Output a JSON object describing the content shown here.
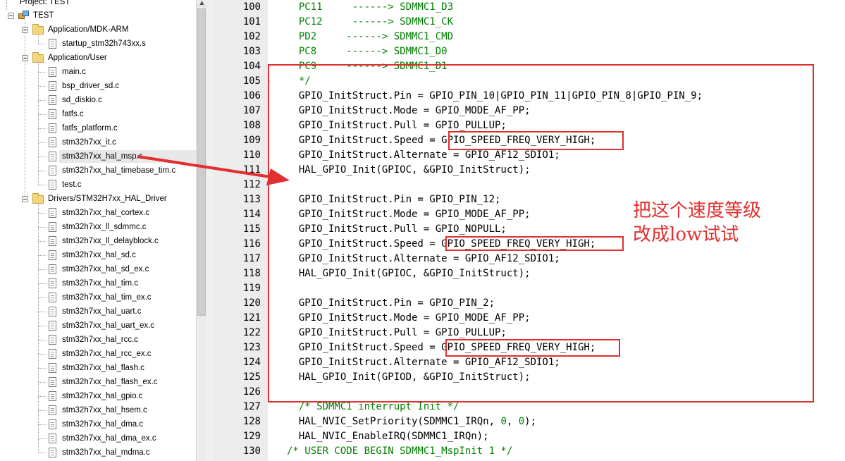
{
  "project_tree": {
    "header_label": "Project: TEST",
    "root_label": "TEST",
    "groups": [
      {
        "label": "Application/MDK-ARM",
        "files": [
          "startup_stm32h743xx.s"
        ]
      },
      {
        "label": "Application/User",
        "files": [
          "main.c",
          "bsp_driver_sd.c",
          "sd_diskio.c",
          "fatfs.c",
          "fatfs_platform.c",
          "stm32h7xx_it.c",
          "stm32h7xx_hal_msp.c",
          "stm32h7xx_hal_timebase_tim.c",
          "test.c"
        ]
      },
      {
        "label": "Drivers/STM32H7xx_HAL_Driver",
        "files": [
          "stm32h7xx_hal_cortex.c",
          "stm32h7xx_ll_sdmmc.c",
          "stm32h7xx_ll_delayblock.c",
          "stm32h7xx_hal_sd.c",
          "stm32h7xx_hal_sd_ex.c",
          "stm32h7xx_hal_tim.c",
          "stm32h7xx_hal_tim_ex.c",
          "stm32h7xx_hal_uart.c",
          "stm32h7xx_hal_uart_ex.c",
          "stm32h7xx_hal_rcc.c",
          "stm32h7xx_hal_rcc_ex.c",
          "stm32h7xx_hal_flash.c",
          "stm32h7xx_hal_flash_ex.c",
          "stm32h7xx_hal_gpio.c",
          "stm32h7xx_hal_hsem.c",
          "stm32h7xx_hal_dma.c",
          "stm32h7xx_hal_dma_ex.c",
          "stm32h7xx_hal_mdma.c"
        ]
      }
    ],
    "selected_file": "stm32h7xx_hal_msp.c"
  },
  "editor": {
    "lines": [
      {
        "no": "100",
        "text": "  PC11     ------> SDMMC1_D3",
        "kind": "comment"
      },
      {
        "no": "101",
        "text": "  PC12     ------> SDMMC1_CK",
        "kind": "comment"
      },
      {
        "no": "102",
        "text": "  PD2     ------> SDMMC1_CMD",
        "kind": "comment"
      },
      {
        "no": "103",
        "text": "  PC8     ------> SDMMC1_D0",
        "kind": "comment"
      },
      {
        "no": "104",
        "text": "  PC9     ------> SDMMC1_D1",
        "kind": "comment"
      },
      {
        "no": "105",
        "text": "  */",
        "kind": "comment"
      },
      {
        "no": "106",
        "text": "  GPIO_InitStruct.Pin = GPIO_PIN_10|GPIO_PIN_11|GPIO_PIN_8|GPIO_PIN_9;",
        "kind": "code"
      },
      {
        "no": "107",
        "text": "  GPIO_InitStruct.Mode = GPIO_MODE_AF_PP;",
        "kind": "code"
      },
      {
        "no": "108",
        "text": "  GPIO_InitStruct.Pull = GPIO_PULLUP;",
        "kind": "code"
      },
      {
        "no": "109",
        "text": "  GPIO_InitStruct.Speed = GPIO_SPEED_FREQ_VERY_HIGH;",
        "kind": "code"
      },
      {
        "no": "110",
        "text": "  GPIO_InitStruct.Alternate = GPIO_AF12_SDIO1;",
        "kind": "code"
      },
      {
        "no": "111",
        "text": "  HAL_GPIO_Init(GPIOC, &GPIO_InitStruct);",
        "kind": "code"
      },
      {
        "no": "112",
        "text": "",
        "kind": "code"
      },
      {
        "no": "113",
        "text": "  GPIO_InitStruct.Pin = GPIO_PIN_12;",
        "kind": "code"
      },
      {
        "no": "114",
        "text": "  GPIO_InitStruct.Mode = GPIO_MODE_AF_PP;",
        "kind": "code"
      },
      {
        "no": "115",
        "text": "  GPIO_InitStruct.Pull = GPIO_NOPULL;",
        "kind": "code"
      },
      {
        "no": "116",
        "text": "  GPIO_InitStruct.Speed = GPIO_SPEED_FREQ_VERY_HIGH;",
        "kind": "code"
      },
      {
        "no": "117",
        "text": "  GPIO_InitStruct.Alternate = GPIO_AF12_SDIO1;",
        "kind": "code"
      },
      {
        "no": "118",
        "text": "  HAL_GPIO_Init(GPIOC, &GPIO_InitStruct);",
        "kind": "code"
      },
      {
        "no": "119",
        "text": "",
        "kind": "code"
      },
      {
        "no": "120",
        "text": "  GPIO_InitStruct.Pin = GPIO_PIN_2;",
        "kind": "code"
      },
      {
        "no": "121",
        "text": "  GPIO_InitStruct.Mode = GPIO_MODE_AF_PP;",
        "kind": "code"
      },
      {
        "no": "122",
        "text": "  GPIO_InitStruct.Pull = GPIO_PULLUP;",
        "kind": "code"
      },
      {
        "no": "123",
        "text": "  GPIO_InitStruct.Speed = GPIO_SPEED_FREQ_VERY_HIGH;",
        "kind": "code"
      },
      {
        "no": "124",
        "text": "  GPIO_InitStruct.Alternate = GPIO_AF12_SDIO1;",
        "kind": "code"
      },
      {
        "no": "125",
        "text": "  HAL_GPIO_Init(GPIOD, &GPIO_InitStruct);",
        "kind": "code"
      },
      {
        "no": "126",
        "text": "",
        "kind": "code"
      },
      {
        "no": "127",
        "text": "  /* SDMMC1 interrupt Init */",
        "kind": "comment"
      },
      {
        "no": "128",
        "text": "  HAL_NVIC_SetPriority(SDMMC1_IRQn, 0, 0);",
        "kind": "code"
      },
      {
        "no": "129",
        "text": "  HAL_NVIC_EnableIRQ(SDMMC1_IRQn);",
        "kind": "code"
      },
      {
        "no": "130",
        "text": "/* USER CODE BEGIN SDMMC1_MspInit 1 */",
        "kind": "comment"
      }
    ]
  },
  "annotation": {
    "text_line1": "把这个速度等级",
    "text_line2": "改成low试试",
    "color": "#e0302f"
  },
  "colors": {
    "comment": "#008000",
    "gutter_bg": "#ececec",
    "highlight_red": "#e0302f",
    "selection_bg": "#e8e8e8"
  }
}
